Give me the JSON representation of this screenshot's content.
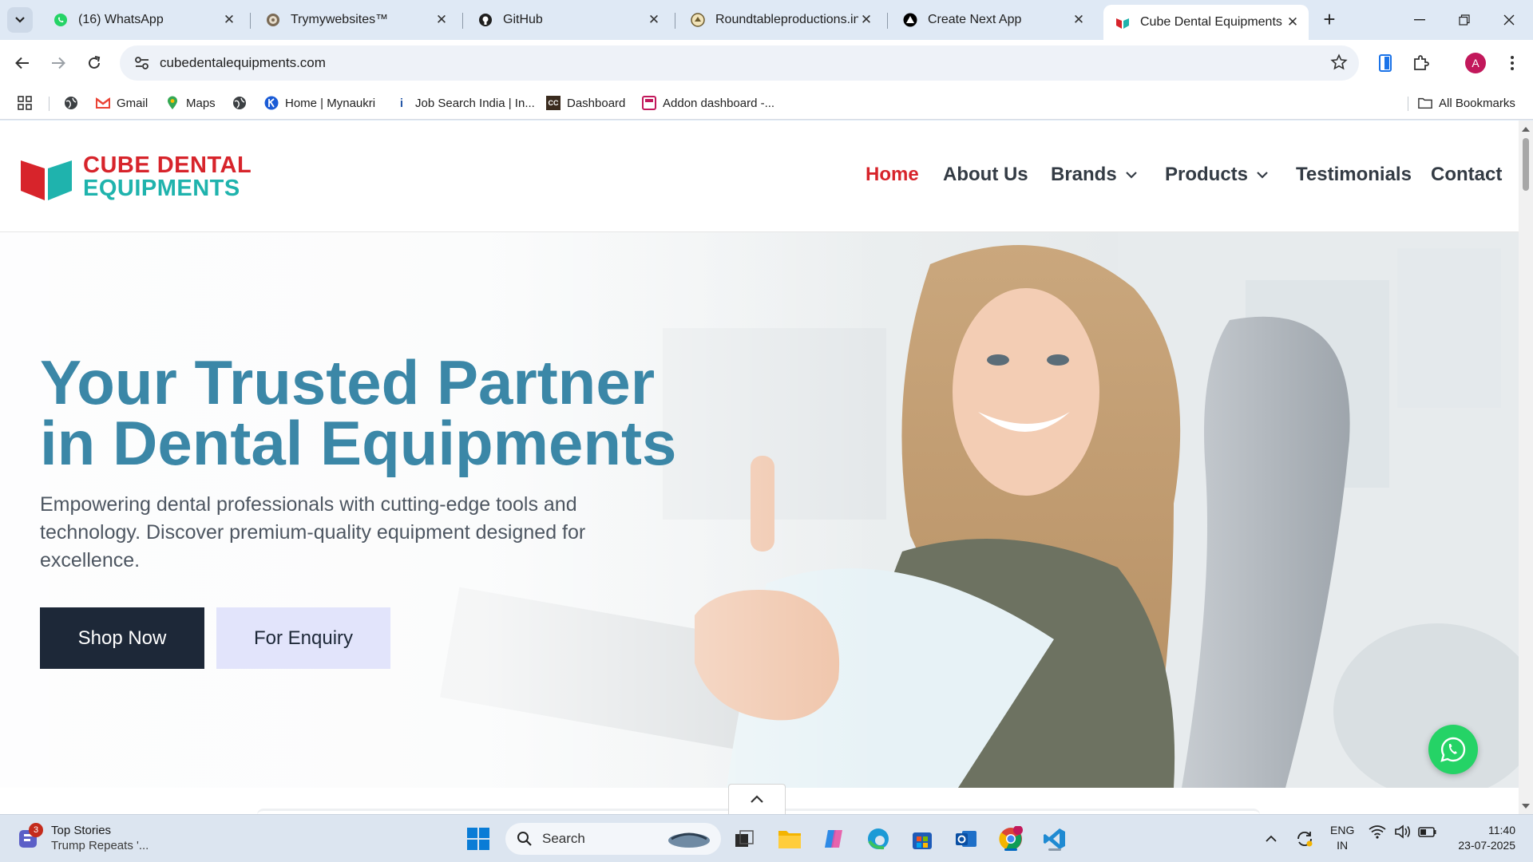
{
  "browser": {
    "tabs": [
      {
        "title": "(16) WhatsApp",
        "icon": "whatsapp-icon"
      },
      {
        "title": "Trymywebsites™",
        "icon": "site-icon"
      },
      {
        "title": "GitHub",
        "icon": "github-icon"
      },
      {
        "title": "Roundtableproductions.in",
        "icon": "roundtable-icon"
      },
      {
        "title": "Create Next App",
        "icon": "nextjs-icon"
      },
      {
        "title": "Cube Dental Equipments -",
        "icon": "cube-dental-icon",
        "active": true
      }
    ],
    "url": "cubedentalequipments.com",
    "profile_initial": "A",
    "bookmarks": [
      {
        "label": "",
        "icon": "globe-icon"
      },
      {
        "label": "Gmail",
        "icon": "gmail-icon"
      },
      {
        "label": "Maps",
        "icon": "maps-icon"
      },
      {
        "label": "",
        "icon": "globe-icon"
      },
      {
        "label": "Home | Mynaukri",
        "icon": "mynaukri-icon"
      },
      {
        "label": "Job Search India | In...",
        "icon": "indeed-icon"
      },
      {
        "label": "Dashboard",
        "icon": "cc-icon"
      },
      {
        "label": "Addon dashboard -...",
        "icon": "addon-icon"
      }
    ],
    "all_bookmarks": "All Bookmarks"
  },
  "site": {
    "logo_line1": "CUBE DENTAL",
    "logo_line2": "EQUIPMENTS",
    "nav": [
      {
        "label": "Home",
        "active": true
      },
      {
        "label": "About Us"
      },
      {
        "label": "Brands",
        "dropdown": true
      },
      {
        "label": "Products",
        "dropdown": true
      },
      {
        "label": "Testimonials"
      },
      {
        "label": "Contact"
      }
    ],
    "hero": {
      "title_line1": "Your Trusted Partner",
      "title_line2": "in Dental Equipments",
      "subtitle": "Empowering dental professionals with cutting-edge tools and technology. Discover premium-quality equipment designed for excellence.",
      "shop_button": "Shop Now",
      "enquiry_button": "For Enquiry"
    },
    "colors": {
      "accent_red": "#d7242b",
      "accent_teal": "#1fb3ad",
      "hero_title": "#3b87a7",
      "dark_button": "#1d2838",
      "light_button": "#e2e4fb",
      "whatsapp_green": "#25d366"
    }
  },
  "taskbar": {
    "news_badge": "3",
    "news_title": "Top Stories",
    "news_headline": "Trump Repeats '...",
    "search_label": "Search",
    "lang_line1": "ENG",
    "lang_line2": "IN",
    "time": "11:40",
    "date": "23-07-2025"
  }
}
